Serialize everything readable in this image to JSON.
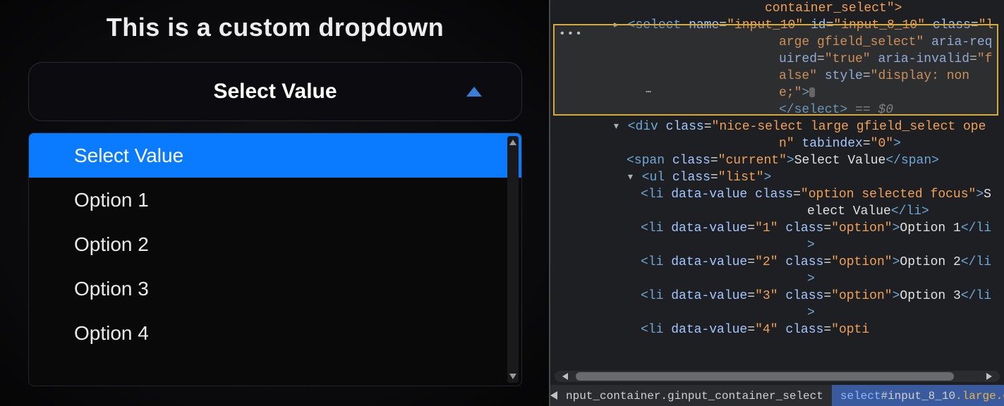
{
  "heading": "This is a custom dropdown",
  "select": {
    "current": "Select Value",
    "name_attr": "input_10",
    "id_attr": "input_8_10",
    "class_attr": "large gfield_select",
    "aria_required": "true",
    "aria_invalid": "false",
    "style_attr": "display: none;"
  },
  "niceselect_class": "nice-select large gfield_select open",
  "tabindex": "0",
  "span_class": "current",
  "span_text": "Select Value",
  "ul_class": "list",
  "options": [
    {
      "li_class": "option selected focus",
      "data_value": "",
      "label": "Select Value"
    },
    {
      "li_class": "option",
      "data_value": "1",
      "label": "Option 1"
    },
    {
      "li_class": "option",
      "data_value": "2",
      "label": "Option 2"
    },
    {
      "li_class": "option",
      "data_value": "3",
      "label": "Option 3"
    },
    {
      "li_class": "option",
      "data_value": "4",
      "label": "Option 4"
    }
  ],
  "prev_node_text": "container_select\">",
  "eq_zero": " == $0",
  "breadcrumb": {
    "prev": "nput_container.ginput_container_select",
    "sel_tag": "select",
    "sel_id": "#input_8_10",
    "sel_cls": ".large.gfield_select"
  }
}
